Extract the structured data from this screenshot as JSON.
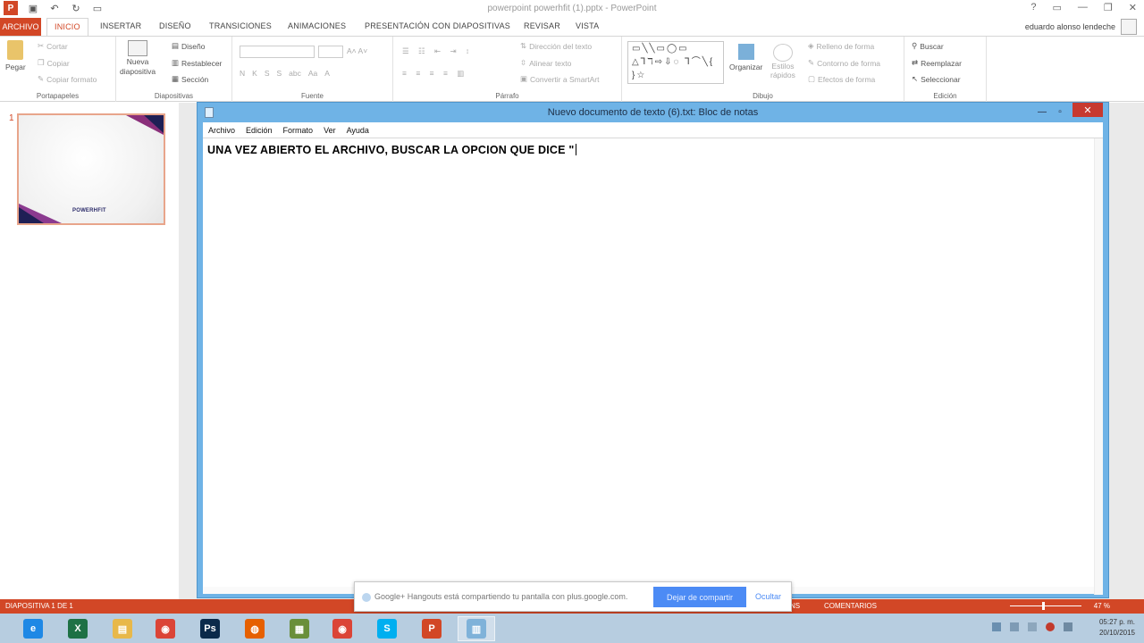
{
  "powerpoint": {
    "title": "powerpoint powerhfit (1).pptx - PowerPoint",
    "file_tab": "ARCHIVO",
    "tabs": [
      "INICIO",
      "INSERTAR",
      "DISEÑO",
      "TRANSICIONES",
      "ANIMACIONES",
      "PRESENTACIÓN CON DIAPOSITIVAS",
      "REVISAR",
      "VISTA"
    ],
    "user": "eduardo alonso lendeche",
    "ribbon": {
      "portapapeles": {
        "label": "Portapapeles",
        "paste": "Pegar",
        "cut": "Cortar",
        "copy": "Copiar",
        "format_painter": "Copiar formato"
      },
      "diapositivas": {
        "label": "Diapositivas",
        "new_slide_1": "Nueva",
        "new_slide_2": "diapositiva",
        "layout": "Diseño",
        "reset": "Restablecer",
        "section": "Sección"
      },
      "fuente": {
        "label": "Fuente",
        "bold": "N",
        "italic": "K",
        "underline": "S",
        "strike": "S",
        "spacing": "abc",
        "case": "Aa"
      },
      "parrafo": {
        "label": "Párrafo",
        "text_direction": "Dirección del texto",
        "align_text": "Alinear texto",
        "smartart": "Convertir a SmartArt"
      },
      "dibujo": {
        "label": "Dibujo",
        "arrange": "Organizar",
        "quick_styles_1": "Estilos",
        "quick_styles_2": "rápidos",
        "fill": "Relleno de forma",
        "outline": "Contorno de forma",
        "effects": "Efectos de forma",
        "shapes": "▭╲╲▭◯▭ △⅂ℸ⇨⇩◌ ⅂⌒╲{ }☆"
      },
      "edicion": {
        "label": "Edición",
        "find": "Buscar",
        "replace": "Reemplazar",
        "select": "Seleccionar"
      }
    },
    "slide_number": "1",
    "thumb_brand": "POWERHFIT",
    "status": {
      "slide": "DIAPOSITIVA 1 DE 1",
      "notes": "NS",
      "comments": "COMENTARIOS",
      "zoom": "47 %"
    }
  },
  "notepad": {
    "title": "Nuevo documento de texto (6).txt: Bloc de notas",
    "menus": [
      "Archivo",
      "Edición",
      "Formato",
      "Ver",
      "Ayuda"
    ],
    "content": "UNA VEZ ABIERTO EL ARCHIVO, BUSCAR LA OPCION QUE DICE \""
  },
  "hangouts": {
    "message": "Google+ Hangouts está compartiendo tu pantalla con plus.google.com.",
    "stop_label": "Dejar de compartir",
    "hide_label": "Ocultar"
  },
  "taskbar": {
    "apps": [
      {
        "name": "internet-explorer",
        "glyph": "e",
        "color": "#1e88e5"
      },
      {
        "name": "excel",
        "glyph": "X",
        "color": "#1e7145"
      },
      {
        "name": "file-explorer",
        "glyph": "▤",
        "color": "#e8b84a"
      },
      {
        "name": "chrome",
        "glyph": "◉",
        "color": "#db4437"
      },
      {
        "name": "photoshop",
        "glyph": "Ps",
        "color": "#0b2a4a"
      },
      {
        "name": "firefox",
        "glyph": "◍",
        "color": "#e66000"
      },
      {
        "name": "calculator",
        "glyph": "▦",
        "color": "#6a8f3a"
      },
      {
        "name": "chrome-2",
        "glyph": "◉",
        "color": "#db4437"
      },
      {
        "name": "skype",
        "glyph": "S",
        "color": "#00aff0"
      },
      {
        "name": "powerpoint",
        "glyph": "P",
        "color": "#d24726"
      },
      {
        "name": "notepad",
        "glyph": "▥",
        "color": "#7fb2d9"
      }
    ],
    "time": "05:27 p. m.",
    "date": "20/10/2015"
  },
  "colors": {
    "pp_accent": "#d24726",
    "notepad_frame": "#6fb3e6",
    "hangouts_blue": "#4c8bf5"
  }
}
